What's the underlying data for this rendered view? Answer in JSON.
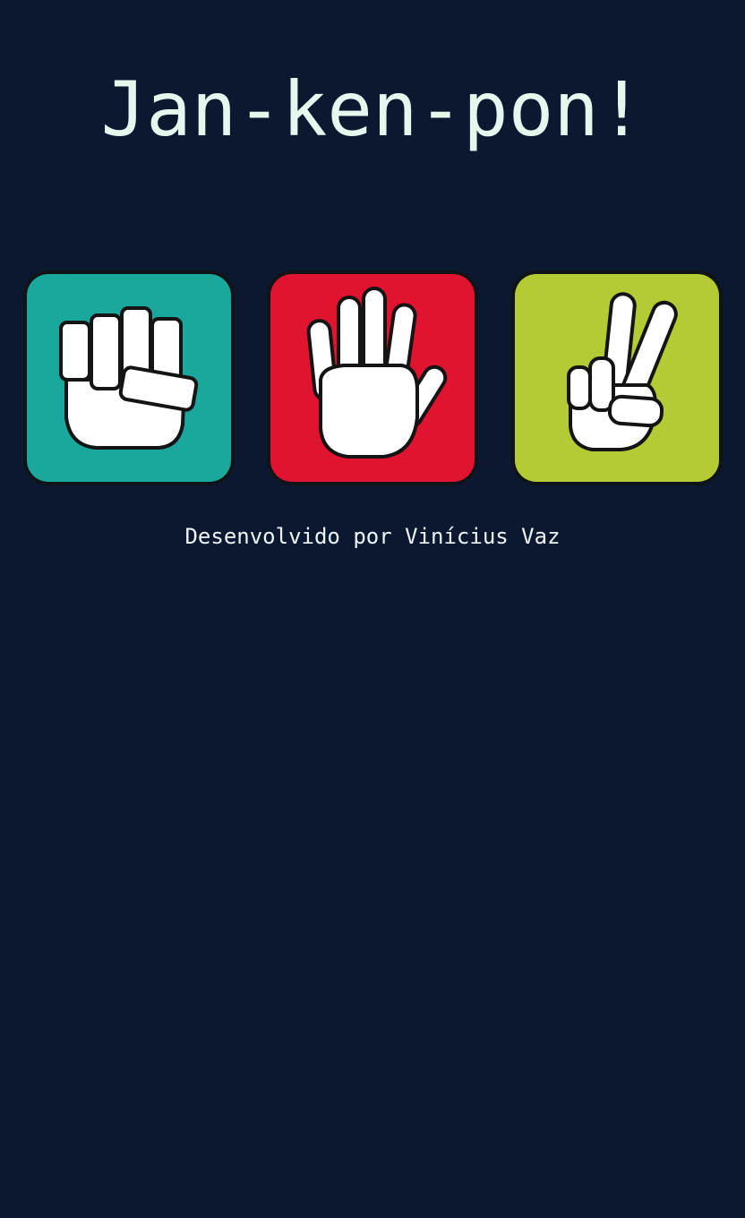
{
  "title": "Jan-ken-pon!",
  "choices": [
    {
      "name": "rock",
      "icon": "rock-fist-icon",
      "color": "#1aa89d"
    },
    {
      "name": "paper",
      "icon": "paper-open-hand-icon",
      "color": "#e01430"
    },
    {
      "name": "scissors",
      "icon": "scissors-peace-hand-icon",
      "color": "#b5cb33"
    }
  ],
  "footer": "Desenvolvido por Vinícius Vaz",
  "colors": {
    "background": "#0b1830",
    "title_text": "#e6f7ee",
    "hand_fill": "#ffffff",
    "hand_outline": "#141414"
  }
}
